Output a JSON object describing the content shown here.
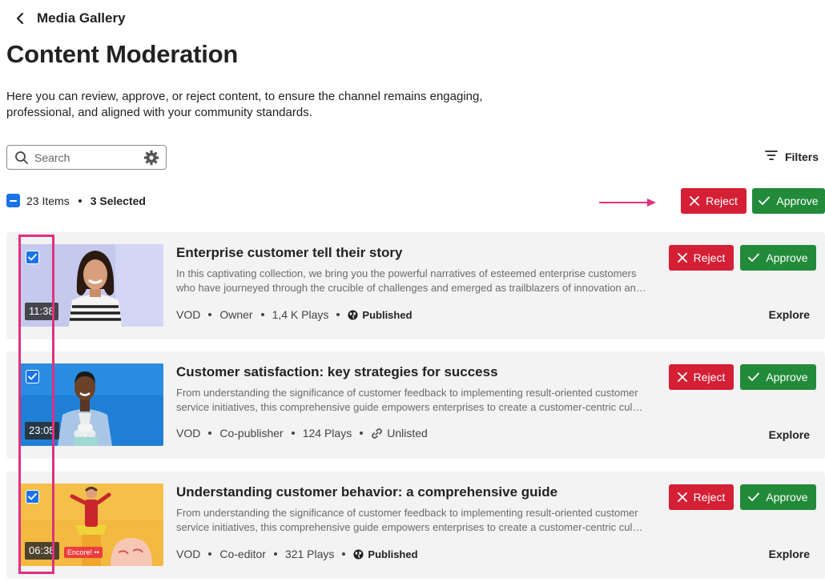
{
  "nav": {
    "back_label": "Media Gallery"
  },
  "page": {
    "title": "Content Moderation",
    "description": "Here you can review, approve, or reject content, to ensure the channel remains engaging, professional, and aligned with your community standards."
  },
  "search": {
    "placeholder": "Search"
  },
  "filters": {
    "label": "Filters"
  },
  "selection": {
    "items_label": "23 Items",
    "selected_label": "3 Selected"
  },
  "actions": {
    "reject_label": "Reject",
    "approve_label": "Approve"
  },
  "colors": {
    "reject": "#d51f35",
    "approve": "#228b3a",
    "accent": "#1a73e8",
    "highlight": "#e0317e"
  },
  "cards": [
    {
      "title": "Enterprise customer tell their story",
      "description": "In this captivating collection, we bring you the powerful narratives of esteemed enterprise customers who have journeyed through the crucible of challenges and emerged as trailblazers of innovation an…",
      "type": "VOD",
      "role": "Owner",
      "plays": "1,4 K Plays",
      "status": "Published",
      "status_icon": "globe-icon",
      "duration": "11:38",
      "reject_label": "Reject",
      "approve_label": "Approve",
      "explore_label": "Explore"
    },
    {
      "title": "Customer satisfaction: key strategies for success",
      "description": "From understanding the significance of customer feedback to implementing result-oriented customer service initiatives, this comprehensive guide empowers enterprises to create a customer-centric cul…",
      "type": "VOD",
      "role": "Co-publisher",
      "plays": "124 Plays",
      "status": "Unlisted",
      "status_icon": "link-icon",
      "duration": "23:05",
      "reject_label": "Reject",
      "approve_label": "Approve",
      "explore_label": "Explore"
    },
    {
      "title": "Understanding customer behavior: a comprehensive guide",
      "description": "From understanding the significance of customer feedback to implementing result-oriented customer service initiatives, this comprehensive guide empowers enterprises to create a customer-centric cul…",
      "type": "VOD",
      "role": "Co-editor",
      "plays": "321 Plays",
      "status": "Published",
      "status_icon": "globe-icon",
      "duration": "06:38",
      "thumb_badge": "Encore! ••",
      "reject_label": "Reject",
      "approve_label": "Approve",
      "explore_label": "Explore"
    }
  ]
}
